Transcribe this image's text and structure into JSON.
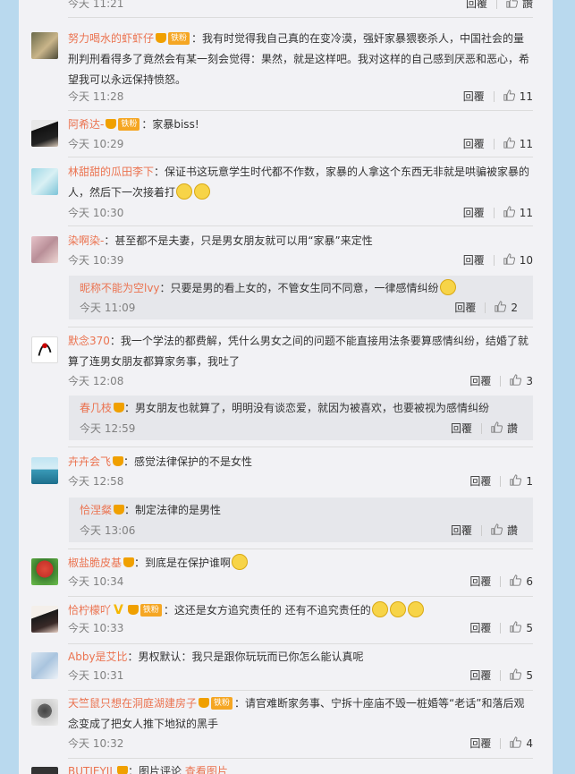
{
  "actions": {
    "reply_label": "回覆"
  },
  "comments": [
    {
      "time": "今天 11:21",
      "likes": "讚"
    },
    {
      "user": "努力喝水的虾虾仔",
      "badge": "铁粉",
      "text": "：我有时觉得我自己真的在变冷漠，强奸家暴猥亵杀人，中国社会的量刑判刑看得多了竟然会有某一刻会觉得：果然，就是这样吧。我对这样的自己感到厌恶和恶心，希望我可以永远保持愤怒。",
      "time": "今天 11:28",
      "likes": "11"
    },
    {
      "user": "阿希达-",
      "badge": "铁粉",
      "text": "：家暴biss!",
      "time": "今天 10:29",
      "likes": "11"
    },
    {
      "user": "林甜甜的瓜田李下",
      "text": "：保证书这玩意学生时代都不作数，家暴的人拿这个东西无非就是哄骗被家暴的人，然后下一次接着打",
      "time": "今天 10:30",
      "likes": "11"
    },
    {
      "user": "染啊染-",
      "text": "：甚至都不是夫妻，只是男女朋友就可以用“家暴”来定性",
      "time": "今天 10:39",
      "likes": "10"
    },
    {
      "user": "昵称不能为空lvy",
      "text": "：只要是男的看上女的，不管女生同不同意，一律感情纠纷",
      "time": "今天 11:09",
      "likes": "2"
    },
    {
      "user": "默念370",
      "text": "：我一个学法的都费解，凭什么男女之间的问题不能直接用法条要算感情纠纷，结婚了就算了连男女朋友都算家务事，我吐了",
      "time": "今天 12:08",
      "likes": "3"
    },
    {
      "user": "春几枝",
      "text": "：男女朋友也就算了，明明没有谈恋爱，就因为被喜欢，也要被视为感情纠纷",
      "time": "今天 12:59",
      "likes": "讚"
    },
    {
      "user": "卉卉会飞",
      "text": "：感觉法律保护的不是女性",
      "time": "今天 12:58",
      "likes": "1"
    },
    {
      "user": "恰涅粲",
      "text": "：制定法律的是男性",
      "time": "今天 13:06",
      "likes": "讚"
    },
    {
      "user": "椒盐脆皮基",
      "text": "：到底是在保护谁啊",
      "time": "今天 10:34",
      "likes": "6"
    },
    {
      "user": "恰柠檬吖",
      "badge": "铁粉",
      "text": "：这还是女方追究责任的  还有不追究责任的",
      "time": "今天 10:33",
      "likes": "5"
    },
    {
      "user": "Abby是艾比",
      "text": "：男权默认：我只是跟你玩玩而已你怎么能认真呢",
      "time": "今天 10:31",
      "likes": "5"
    },
    {
      "user": "天竺鼠只想在洞庭湖建房子",
      "badge": "铁粉",
      "text": "：请官难断家务事、宁拆十座庙不毁一桩婚等“老话”和落后观念变成了把女人推下地狱的黑手",
      "time": "今天 10:32",
      "likes": "4"
    },
    {
      "user": "BUTIEYIL",
      "text": "：图片评论",
      "extra": "查看图片"
    }
  ]
}
